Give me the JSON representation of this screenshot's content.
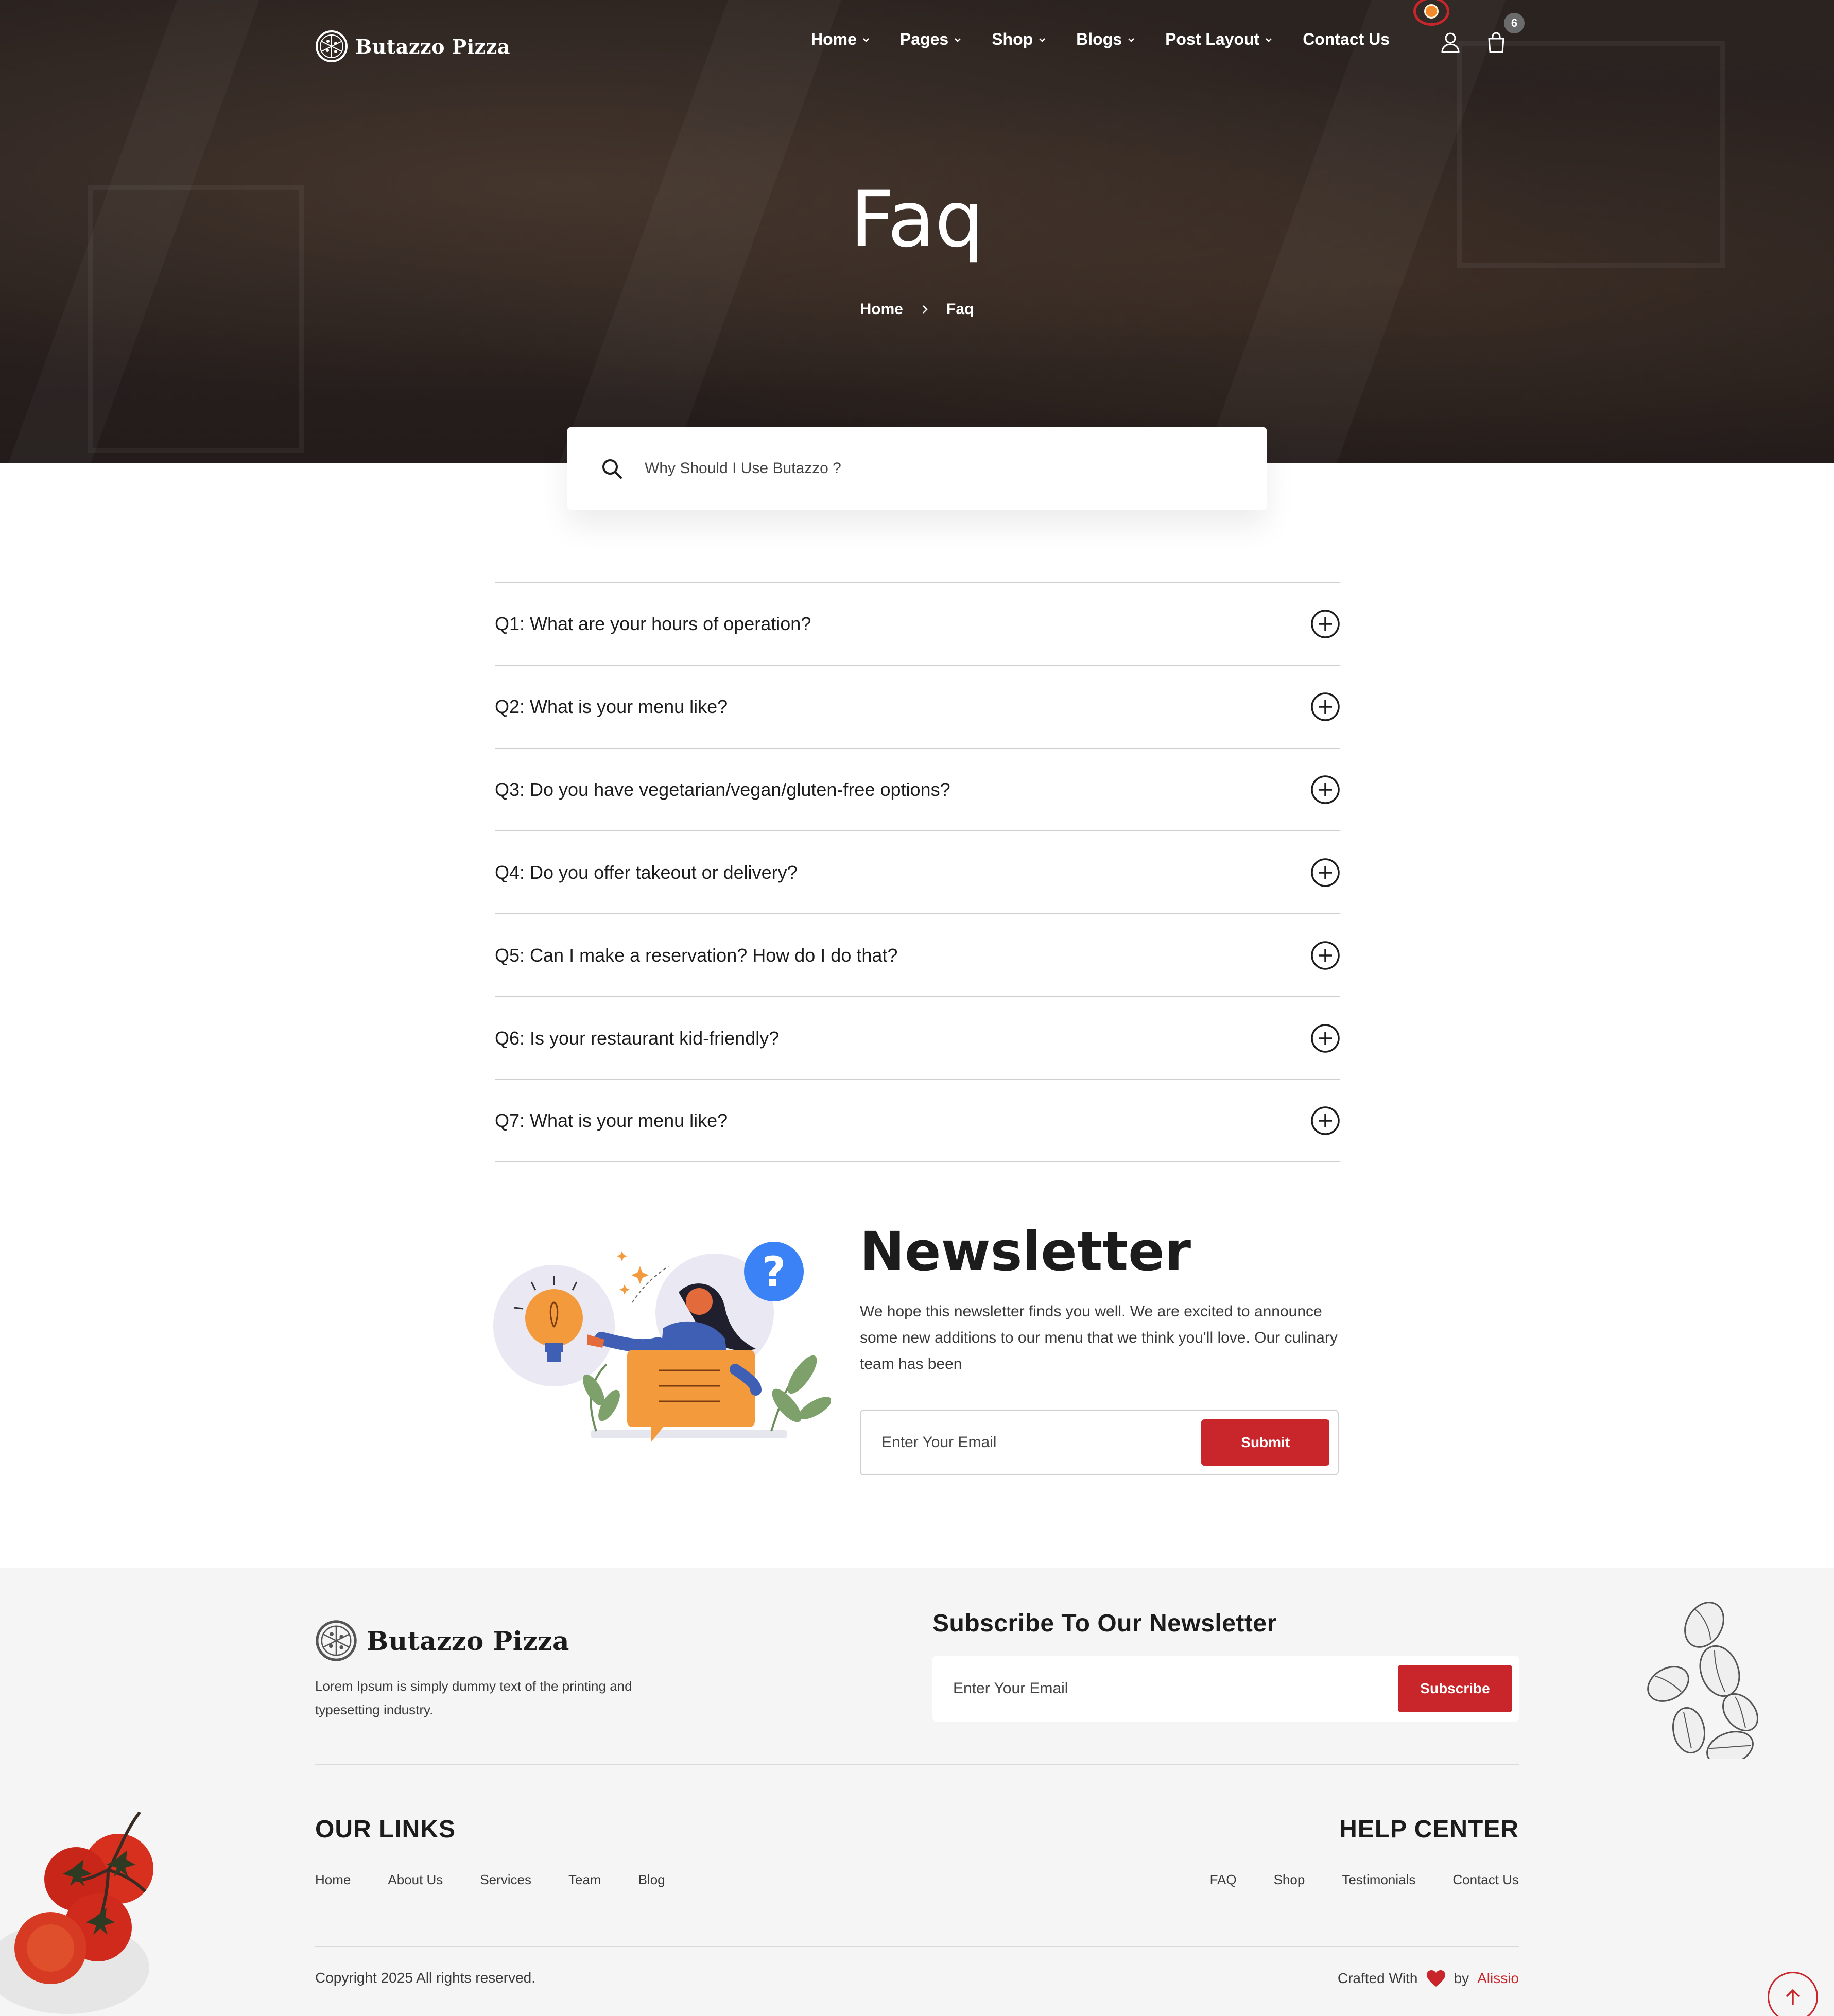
{
  "brand": {
    "name": "Butazzo Pizza",
    "accent": "#c8262b"
  },
  "nav": {
    "items": [
      {
        "label": "Home",
        "has_dropdown": true
      },
      {
        "label": "Pages",
        "has_dropdown": true
      },
      {
        "label": "Shop",
        "has_dropdown": true
      },
      {
        "label": "Blogs",
        "has_dropdown": true
      },
      {
        "label": "Post Layout",
        "has_dropdown": true
      },
      {
        "label": "Contact Us",
        "has_dropdown": false
      }
    ],
    "cart_count": "6",
    "icons": [
      "user-icon",
      "shopping-bag-icon"
    ]
  },
  "hero": {
    "title": "Faq",
    "breadcrumb": {
      "home": "Home",
      "current": "Faq"
    }
  },
  "search": {
    "placeholder": "Why Should I Use Butazzo ?"
  },
  "faq": {
    "items": [
      "Q1: What are your hours of operation?",
      "Q2: What is your menu like?",
      "Q3: Do you have vegetarian/vegan/gluten-free options?",
      "Q4: Do you offer takeout or delivery?",
      "Q5: Can I make a reservation? How do I do that?",
      "Q6: Is your restaurant kid-friendly?",
      "Q7: What is your menu like?"
    ]
  },
  "newsletter": {
    "title": "Newsletter",
    "text": "We hope this newsletter finds you well. We are excited to announce some new additions to our menu that we think you'll love. Our culinary team has been",
    "placeholder": "Enter Your Email",
    "button": "Submit"
  },
  "footer": {
    "brand": "Butazzo Pizza",
    "description": "Lorem Ipsum is simply dummy text of the printing and typesetting industry.",
    "subscribe_title": "Subscribe To Our Newsletter",
    "subscribe_placeholder": "Enter Your Email",
    "subscribe_button": "Subscribe",
    "our_links_title": "OUR LINKS",
    "our_links": [
      "Home",
      "About Us",
      "Services",
      "Team",
      "Blog"
    ],
    "help_center_title": "HELP CENTER",
    "help_links": [
      "FAQ",
      "Shop",
      "Testimonials",
      "Contact Us"
    ],
    "copyright": "Copyright 2025 All rights reserved.",
    "crafted_with": "Crafted With",
    "crafted_by": "by",
    "author": "Alissio"
  }
}
